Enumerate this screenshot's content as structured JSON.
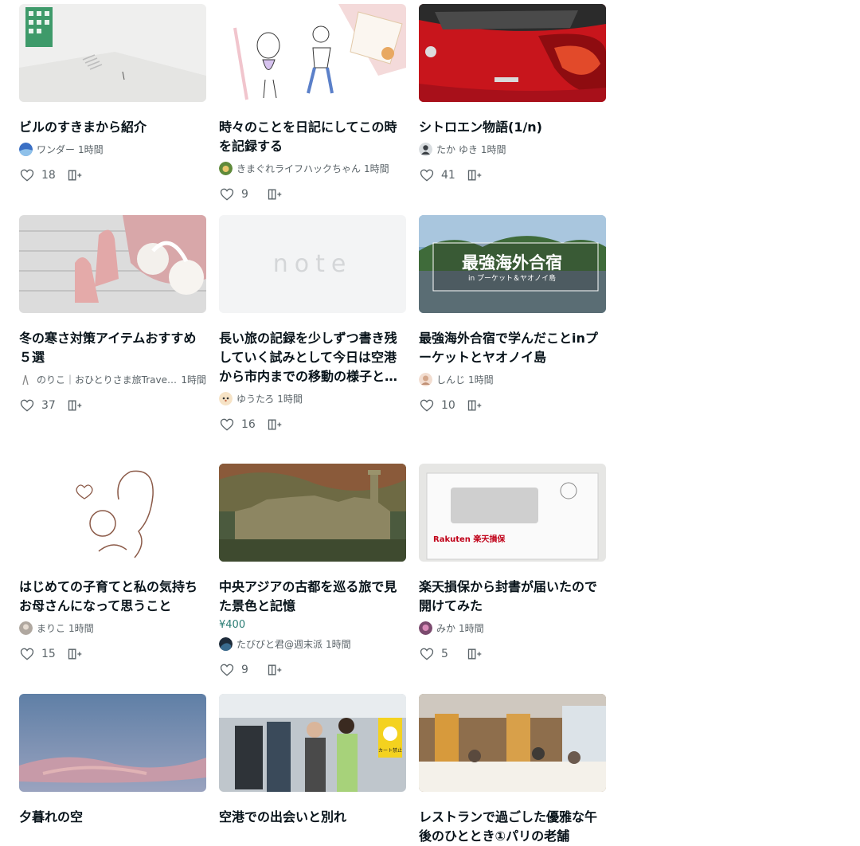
{
  "cards": [
    {
      "title": "ビルのすきまから紹介",
      "author": "ワンダー",
      "time": "1時間",
      "likes": "18",
      "price": ""
    },
    {
      "title": "時々のことを日記にしてこの時を記録する",
      "author": "きまぐれライフハックちゃん",
      "time": "1時間",
      "likes": "9",
      "price": ""
    },
    {
      "title": "シトロエン物語(1/n)",
      "author": "たか ゆき",
      "time": "1時間",
      "likes": "41",
      "price": ""
    },
    {
      "title": "冬の寒さ対策アイテムおすすめ５選",
      "author": "のりこ｜おひとりさま旅TravellinGorgeous",
      "time": "1時間",
      "likes": "37",
      "price": ""
    },
    {
      "title": "長い旅の記録を少しずつ書き残していく試みとして今日は空港から市内までの移動の様子と初めての街で感じたことを中心に書いていきたいと思います",
      "author": "ゆうたろ",
      "time": "1時間",
      "likes": "16",
      "price": ""
    },
    {
      "title": "最強海外合宿で学んだことinプーケットとヤオノイ島",
      "author": "しんじ",
      "time": "1時間",
      "likes": "10",
      "price": ""
    },
    {
      "title": "はじめての子育てと私の気持ち お母さんになって思うこと",
      "author": "まりこ",
      "time": "1時間",
      "likes": "15",
      "price": ""
    },
    {
      "title": "中央アジアの古都を巡る旅で見た景色と記憶",
      "price": "¥400",
      "author": "たびびと君@週末派",
      "time": "1時間",
      "likes": "9"
    },
    {
      "title": "楽天損保から封書が届いたので開けてみた",
      "author": "みか",
      "time": "1時間",
      "likes": "5",
      "price": ""
    },
    {
      "title": "夕暮れの空",
      "author": "",
      "time": "",
      "likes": "",
      "price": ""
    },
    {
      "title": "空港での出会いと別れ",
      "author": "",
      "time": "",
      "likes": "",
      "price": ""
    },
    {
      "title": "レストランで過ごした優雅な午後のひととき①パリの老舗",
      "author": "",
      "time": "",
      "likes": "",
      "price": ""
    }
  ],
  "thumb_texts": {
    "note_logo": "note",
    "camp_title": "最強海外合宿",
    "camp_sub": "in プーケット＆ヤオノイ島",
    "envelope_brand": "Rakuten 楽天損保",
    "cart_sign": "カート禁止"
  },
  "colors": {
    "heart": "#5a6368",
    "price": "#2a7d74"
  }
}
